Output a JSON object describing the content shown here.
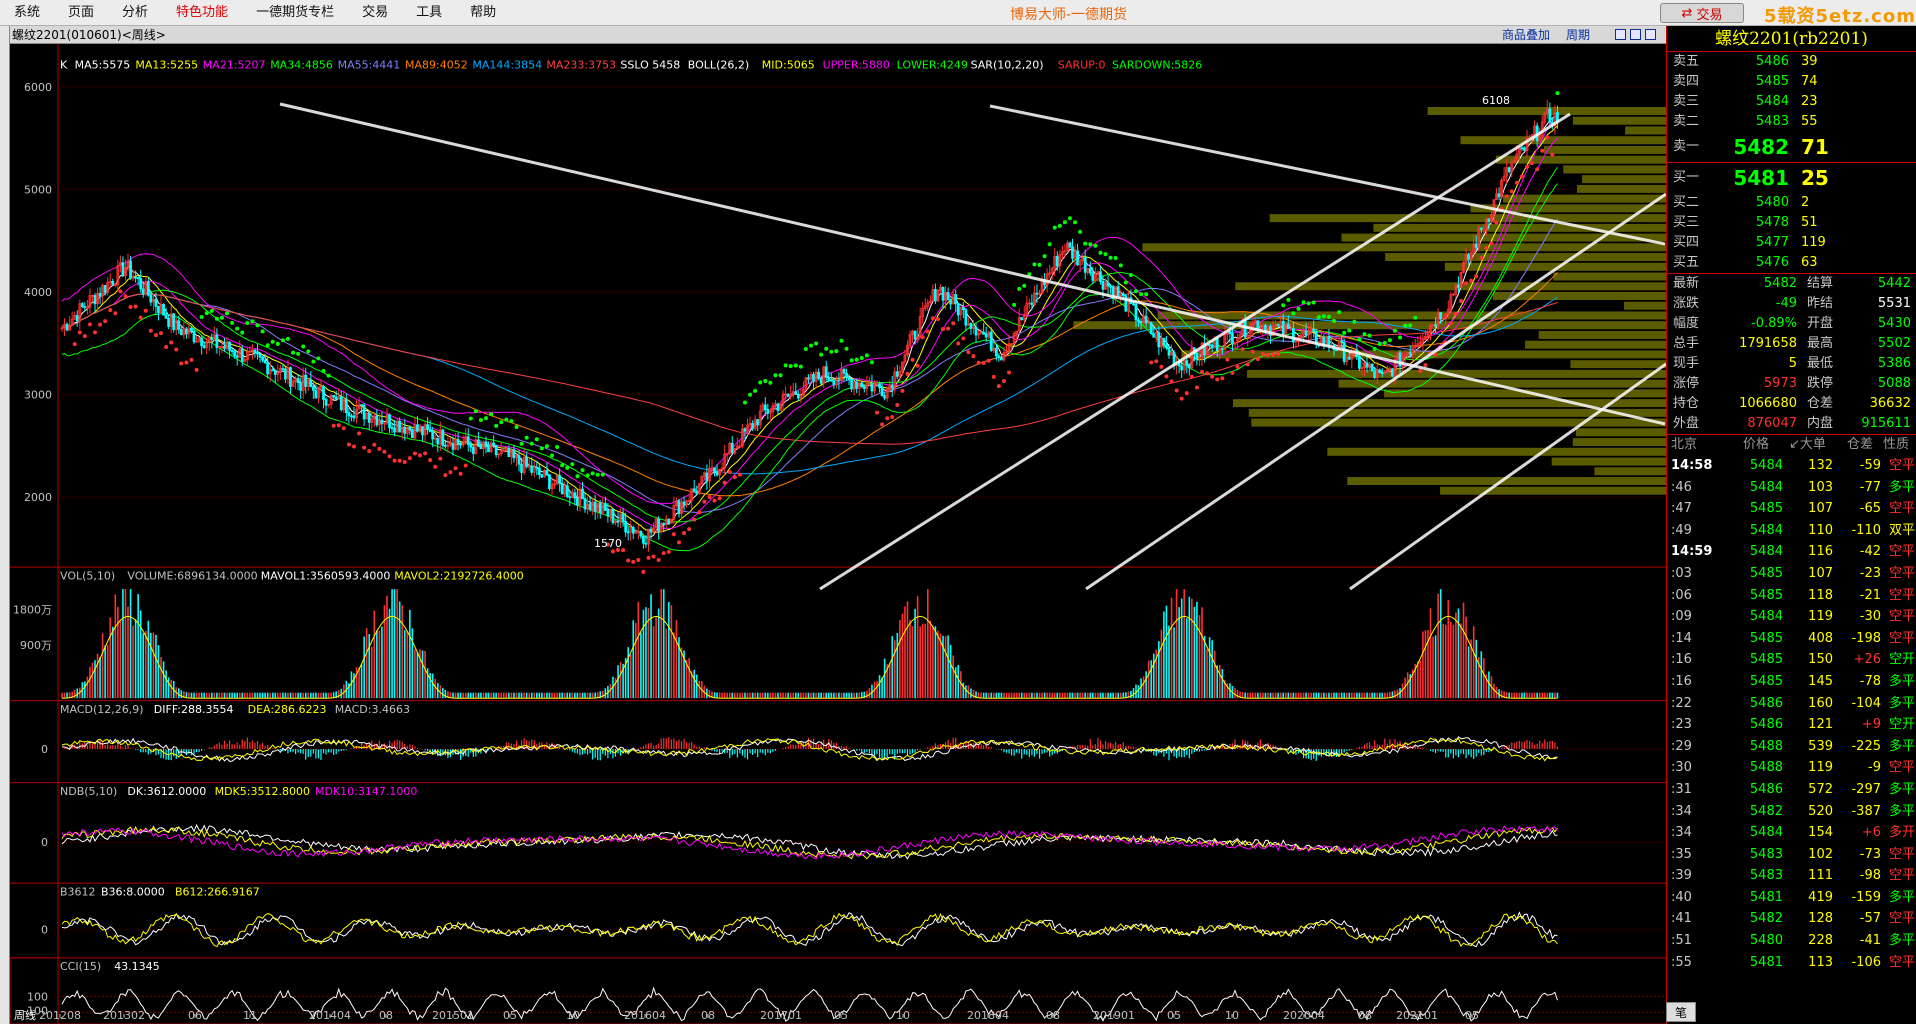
{
  "menu": [
    "系统",
    "页面",
    "分析",
    "特色功能",
    "一德期货专栏",
    "交易",
    "工具",
    "帮助"
  ],
  "app_title": "博易大师-一德期货",
  "trade_button": "交易",
  "watermark": "5载资5etz.com",
  "chart": {
    "title": "螺纹2201(010601)<周线>",
    "links": [
      "商品叠加",
      "周期"
    ],
    "main_legend": [
      {
        "t": "K",
        "c": "#ffffff"
      },
      {
        "t": "MA5:5575",
        "c": "#ffffff"
      },
      {
        "t": "MA13:5255",
        "c": "#ffff00"
      },
      {
        "t": "MA21:5207",
        "c": "#ff00ff"
      },
      {
        "t": "MA34:4856",
        "c": "#00ff00"
      },
      {
        "t": "MA55:4441",
        "c": "#8080ff"
      },
      {
        "t": "MA89:4052",
        "c": "#ff8000"
      },
      {
        "t": "MA144:3854",
        "c": "#00aaff"
      },
      {
        "t": "MA233:3753",
        "c": "#ff4040"
      },
      {
        "t": "SSLO 5458",
        "c": "#ffffff"
      },
      {
        "t": "BOLL(26,2)",
        "c": "#ffffff"
      },
      {
        "t": "MID:5065",
        "c": "#ffff00"
      },
      {
        "t": "UPPER:5880",
        "c": "#ff00ff"
      },
      {
        "t": "LOWER:4249",
        "c": "#00ff00"
      },
      {
        "t": "SAR(10,2,20)",
        "c": "#ffffff"
      },
      {
        "t": "SARUP:0",
        "c": "#ff3030"
      },
      {
        "t": "SARDOWN:5826",
        "c": "#00ff00"
      }
    ],
    "price_ticks": [
      "6000",
      "5000",
      "4000",
      "3000",
      "2000"
    ],
    "annotations": {
      "high": "6108",
      "low": "1570"
    },
    "vol_legend": [
      {
        "t": "VOL(5,10)",
        "c": "#c0c0c0"
      },
      {
        "t": "VOLUME:6896134.0000",
        "c": "#c0c0c0"
      },
      {
        "t": "MAVOL1:3560593.4000",
        "c": "#ffffff"
      },
      {
        "t": "MAVOL2:2192726.4000",
        "c": "#ffff00"
      }
    ],
    "vol_ticks": [
      "1800万",
      "900万"
    ],
    "macd_legend": [
      {
        "t": "MACD(12,26,9)",
        "c": "#c0c0c0"
      },
      {
        "t": "DIFF:288.3554",
        "c": "#ffffff"
      },
      {
        "t": "DEA:286.6223",
        "c": "#ffff00"
      },
      {
        "t": "MACD:3.4663",
        "c": "#c0c0c0"
      }
    ],
    "ndb_legend": [
      {
        "t": "NDB(5,10)",
        "c": "#c0c0c0"
      },
      {
        "t": "DK:3612.0000",
        "c": "#ffffff"
      },
      {
        "t": "MDK5:3512.8000",
        "c": "#ffff00"
      },
      {
        "t": "MDK10:3147.1000",
        "c": "#ff00ff"
      }
    ],
    "b3612_legend": [
      {
        "t": "B3612",
        "c": "#c0c0c0"
      },
      {
        "t": "B36:8.0000",
        "c": "#ffffff"
      },
      {
        "t": "B612:266.9167",
        "c": "#ffff00"
      }
    ],
    "cci_legend": [
      {
        "t": "CCI(15)",
        "c": "#c0c0c0"
      },
      {
        "t": "43.1345",
        "c": "#ffffff"
      }
    ],
    "zero": "0",
    "cci_ticks": [
      "100",
      "-100"
    ],
    "period_label": "周线",
    "x_labels": [
      "201208",
      "201302",
      "06",
      "11",
      "201404",
      "08",
      "201501",
      "05",
      "10",
      "201604",
      "08",
      "201701",
      "05",
      "10",
      "201804",
      "08",
      "201901",
      "05",
      "10",
      "202004",
      "08",
      "202101",
      "05"
    ]
  },
  "quote": {
    "title": "螺纹2201(rb2201)",
    "asks": [
      {
        "l": "卖五",
        "p": "5486",
        "v": "39"
      },
      {
        "l": "卖四",
        "p": "5485",
        "v": "74"
      },
      {
        "l": "卖三",
        "p": "5484",
        "v": "23"
      },
      {
        "l": "卖二",
        "p": "5483",
        "v": "55"
      }
    ],
    "ask1": {
      "l": "卖一",
      "p": "5482",
      "v": "71"
    },
    "bid1": {
      "l": "买一",
      "p": "5481",
      "v": "25"
    },
    "bids": [
      {
        "l": "买二",
        "p": "5480",
        "v": "2"
      },
      {
        "l": "买三",
        "p": "5478",
        "v": "51"
      },
      {
        "l": "买四",
        "p": "5477",
        "v": "119"
      },
      {
        "l": "买五",
        "p": "5476",
        "v": "63"
      }
    ],
    "stats": [
      {
        "l1": "最新",
        "v1": "5482",
        "c1": "green",
        "l2": "结算",
        "v2": "5442",
        "c2": "green"
      },
      {
        "l1": "涨跌",
        "v1": "-49",
        "c1": "green",
        "l2": "昨结",
        "v2": "5531",
        "c2": "white"
      },
      {
        "l1": "幅度",
        "v1": "-0.89%",
        "c1": "green",
        "l2": "开盘",
        "v2": "5430",
        "c2": "green"
      },
      {
        "l1": "总手",
        "v1": "1791658",
        "c1": "yellow",
        "l2": "最高",
        "v2": "5502",
        "c2": "green"
      },
      {
        "l1": "现手",
        "v1": "5",
        "c1": "yellow",
        "l2": "最低",
        "v2": "5386",
        "c2": "green"
      },
      {
        "l1": "涨停",
        "v1": "5973",
        "c1": "red",
        "l2": "跌停",
        "v2": "5088",
        "c2": "green"
      },
      {
        "l1": "持仓",
        "v1": "1066680",
        "c1": "yellow",
        "l2": "仓差",
        "v2": "36632",
        "c2": "yellow"
      },
      {
        "l1": "外盘",
        "v1": "876047",
        "c1": "red",
        "l2": "内盘",
        "v2": "915611",
        "c2": "green"
      }
    ],
    "ticks_header": [
      "北京",
      "价格",
      "↙大单",
      "仓差",
      "性质"
    ],
    "ticks": [
      {
        "t": "14:58",
        "p": "5484",
        "v": "132",
        "c": "-59",
        "ty": "空平",
        "tc": "red",
        "full": true
      },
      {
        "t": ":46",
        "p": "5484",
        "v": "103",
        "c": "-77",
        "ty": "多平",
        "tc": "green"
      },
      {
        "t": ":47",
        "p": "5485",
        "v": "107",
        "c": "-65",
        "ty": "空平",
        "tc": "red"
      },
      {
        "t": ":49",
        "p": "5484",
        "v": "110",
        "c": "-110",
        "ty": "双平",
        "tc": "yellow"
      },
      {
        "t": "14:59",
        "p": "5484",
        "v": "116",
        "c": "-42",
        "ty": "空平",
        "tc": "red",
        "full": true
      },
      {
        "t": ":03",
        "p": "5485",
        "v": "107",
        "c": "-23",
        "ty": "空平",
        "tc": "red"
      },
      {
        "t": ":06",
        "p": "5485",
        "v": "118",
        "c": "-21",
        "ty": "空平",
        "tc": "red"
      },
      {
        "t": ":09",
        "p": "5484",
        "v": "119",
        "c": "-30",
        "ty": "空平",
        "tc": "red"
      },
      {
        "t": ":14",
        "p": "5485",
        "v": "408",
        "c": "-198",
        "ty": "空平",
        "tc": "red"
      },
      {
        "t": ":16",
        "p": "5485",
        "v": "150",
        "c": "+26",
        "ty": "空开",
        "tc": "green"
      },
      {
        "t": ":16",
        "p": "5485",
        "v": "145",
        "c": "-78",
        "ty": "多平",
        "tc": "green"
      },
      {
        "t": ":22",
        "p": "5486",
        "v": "160",
        "c": "-104",
        "ty": "多平",
        "tc": "green"
      },
      {
        "t": ":23",
        "p": "5486",
        "v": "121",
        "c": "+9",
        "ty": "空开",
        "tc": "green"
      },
      {
        "t": ":29",
        "p": "5488",
        "v": "539",
        "c": "-225",
        "ty": "多平",
        "tc": "green"
      },
      {
        "t": ":30",
        "p": "5488",
        "v": "119",
        "c": "-9",
        "ty": "空平",
        "tc": "red"
      },
      {
        "t": ":31",
        "p": "5486",
        "v": "572",
        "c": "-297",
        "ty": "多平",
        "tc": "green"
      },
      {
        "t": ":34",
        "p": "5482",
        "v": "520",
        "c": "-387",
        "ty": "多平",
        "tc": "green"
      },
      {
        "t": ":34",
        "p": "5484",
        "v": "154",
        "c": "+6",
        "ty": "多开",
        "tc": "red"
      },
      {
        "t": ":35",
        "p": "5483",
        "v": "102",
        "c": "-73",
        "ty": "空平",
        "tc": "red"
      },
      {
        "t": ":39",
        "p": "5483",
        "v": "111",
        "c": "-98",
        "ty": "空平",
        "tc": "red"
      },
      {
        "t": ":40",
        "p": "5481",
        "v": "419",
        "c": "-159",
        "ty": "多平",
        "tc": "green"
      },
      {
        "t": ":41",
        "p": "5482",
        "v": "128",
        "c": "-57",
        "ty": "空平",
        "tc": "red"
      },
      {
        "t": ":51",
        "p": "5480",
        "v": "228",
        "c": "-41",
        "ty": "多平",
        "tc": "green"
      },
      {
        "t": ":55",
        "p": "5481",
        "v": "113",
        "c": "-106",
        "ty": "空平",
        "tc": "red"
      }
    ],
    "bottom_tab": "笔"
  }
}
